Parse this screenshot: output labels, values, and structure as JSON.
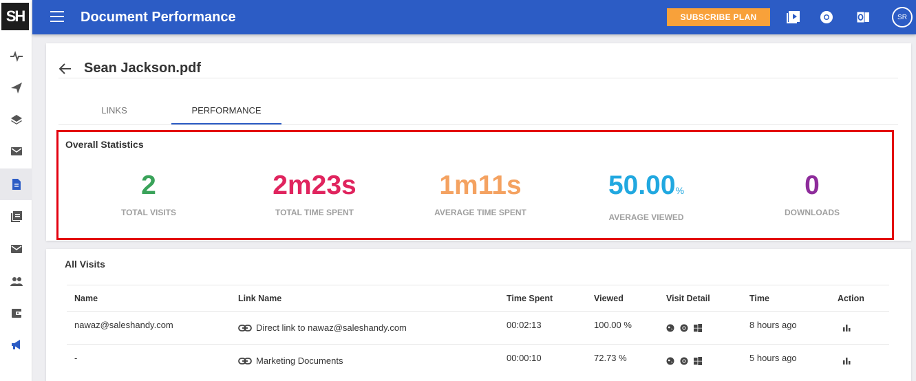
{
  "header": {
    "title": "Document Performance",
    "subscribe_label": "SUBSCRIBE PLAN",
    "avatar_initials": "SR",
    "logo": "SH",
    "accent_color": "#2c5cc5",
    "subscribe_color": "#f8a13a"
  },
  "sidebar": {
    "items": [
      {
        "icon": "pulse-icon"
      },
      {
        "icon": "paper-plane-icon"
      },
      {
        "icon": "layers-icon"
      },
      {
        "icon": "inbox-icon"
      },
      {
        "icon": "document-icon",
        "active": true
      },
      {
        "icon": "library-icon"
      },
      {
        "icon": "mail-icon"
      },
      {
        "icon": "people-icon"
      },
      {
        "icon": "wallet-icon"
      },
      {
        "icon": "megaphone-icon"
      }
    ]
  },
  "document": {
    "title": "Sean Jackson.pdf"
  },
  "tabs": [
    {
      "label": "LINKS",
      "active": false
    },
    {
      "label": "PERFORMANCE",
      "active": true
    }
  ],
  "overall_statistics": {
    "heading": "Overall Statistics",
    "stats": [
      {
        "value": "2",
        "unit": "",
        "label": "TOTAL VISITS",
        "color": "#3aa35a"
      },
      {
        "value": "2m23s",
        "unit": "",
        "label": "TOTAL TIME SPENT",
        "color": "#e0245e"
      },
      {
        "value": "1m11s",
        "unit": "",
        "label": "AVERAGE TIME SPENT",
        "color": "#f4a261"
      },
      {
        "value": "50.00",
        "unit": "%",
        "label": "AVERAGE VIEWED",
        "color": "#21a8e0"
      },
      {
        "value": "0",
        "unit": "",
        "label": "DOWNLOADS",
        "color": "#8e2c9b"
      }
    ]
  },
  "all_visits": {
    "heading": "All Visits",
    "columns": [
      "Name",
      "Link Name",
      "Time Spent",
      "Viewed",
      "Visit Detail",
      "Time",
      "Action"
    ],
    "rows": [
      {
        "name": "nawaz@saleshandy.com",
        "link_name": "Direct link to nawaz@saleshandy.com",
        "time_spent": "00:02:13",
        "viewed": "100.00 %",
        "time": "8 hours ago"
      },
      {
        "name": "-",
        "link_name": "Marketing Documents",
        "time_spent": "00:00:10",
        "viewed": "72.73 %",
        "time": "5 hours ago"
      }
    ]
  }
}
